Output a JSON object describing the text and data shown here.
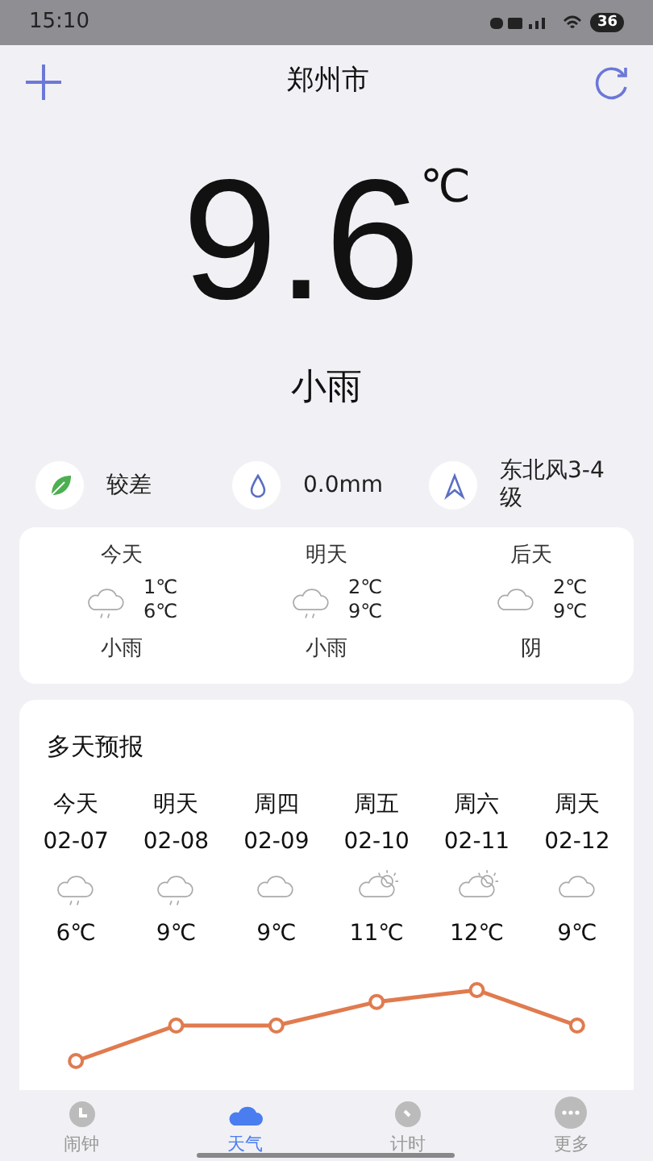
{
  "status_bar": {
    "time": "15:10",
    "battery": "36"
  },
  "header": {
    "city": "郑州市"
  },
  "current": {
    "temperature": "9.6",
    "unit": "℃",
    "condition": "小雨"
  },
  "details": [
    {
      "kind": "leaf",
      "text": "较差"
    },
    {
      "kind": "drop",
      "text": "0.0mm"
    },
    {
      "kind": "wind",
      "text": "东北风3-4级"
    }
  ],
  "three_days": [
    {
      "day": "今天",
      "kind": "rain",
      "low": "1℃",
      "high": "6℃",
      "condition": "小雨"
    },
    {
      "day": "明天",
      "kind": "rain",
      "low": "2℃",
      "high": "9℃",
      "condition": "小雨"
    },
    {
      "day": "后天",
      "kind": "cloud",
      "low": "2℃",
      "high": "9℃",
      "condition": "阴"
    }
  ],
  "forecast": {
    "title": "多天预报",
    "days": [
      {
        "day": "今天",
        "date": "02-07",
        "kind": "rain",
        "temp": "6℃"
      },
      {
        "day": "明天",
        "date": "02-08",
        "kind": "rain",
        "temp": "9℃"
      },
      {
        "day": "周四",
        "date": "02-09",
        "kind": "cloud",
        "temp": "9℃"
      },
      {
        "day": "周五",
        "date": "02-10",
        "kind": "sun",
        "temp": "11℃"
      },
      {
        "day": "周六",
        "date": "02-11",
        "kind": "sun",
        "temp": "12℃"
      },
      {
        "day": "周天",
        "date": "02-12",
        "kind": "cloud",
        "temp": "9℃"
      }
    ]
  },
  "tabs": [
    {
      "label": "闹钟",
      "kind": "alarm",
      "selected": false
    },
    {
      "label": "天气",
      "kind": "weather",
      "selected": true
    },
    {
      "label": "计时",
      "kind": "timer",
      "selected": false
    },
    {
      "label": "更多",
      "kind": "more",
      "selected": false
    }
  ]
}
